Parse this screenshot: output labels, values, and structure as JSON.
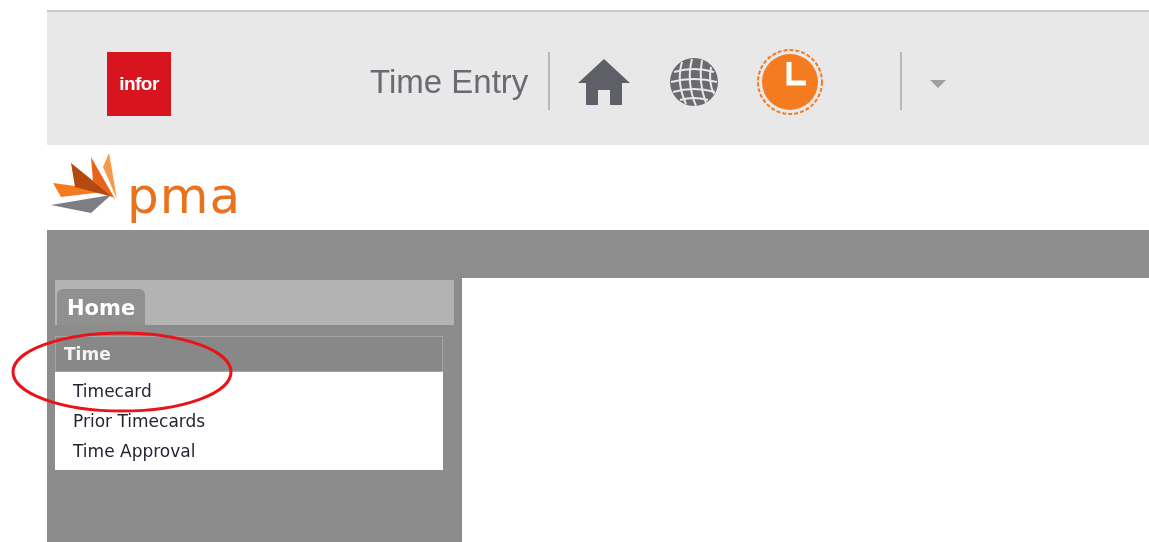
{
  "header": {
    "brand": "infor",
    "app_title": "Time Entry",
    "toolbar": [
      {
        "kind": "home",
        "selected": false
      },
      {
        "kind": "globe",
        "selected": false
      },
      {
        "kind": "clock",
        "selected": true
      }
    ]
  },
  "logo": {
    "text": "pma"
  },
  "sidebar": {
    "tabs": [
      {
        "label": "Home",
        "selected": true
      }
    ],
    "section": {
      "title": "Time",
      "items": [
        {
          "label": "Timecard"
        },
        {
          "label": "Prior Timecards"
        },
        {
          "label": "Time Approval"
        }
      ]
    }
  },
  "annotation": {
    "kind": "ellipse"
  }
}
